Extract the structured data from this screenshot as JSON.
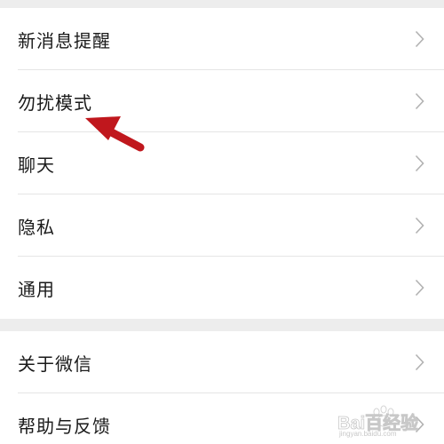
{
  "settings": {
    "group1": [
      {
        "label": "新消息提醒"
      },
      {
        "label": "勿扰模式"
      },
      {
        "label": "聊天"
      },
      {
        "label": "隐私"
      },
      {
        "label": "通用"
      }
    ],
    "group2": [
      {
        "label": "关于微信"
      },
      {
        "label": "帮助与反馈"
      }
    ]
  },
  "annotation": {
    "arrow_color": "#c0171d",
    "points_to": "勿扰模式"
  },
  "watermark": {
    "icon": "baidu-paw-icon",
    "text": "Bai百经验",
    "url_text": "jingyan.baidu.com"
  },
  "colors": {
    "background": "#ededed",
    "card": "#ffffff",
    "text": "#1a1a1a",
    "chevron": "#b2b2b2",
    "divider": "#e5e5e5"
  }
}
